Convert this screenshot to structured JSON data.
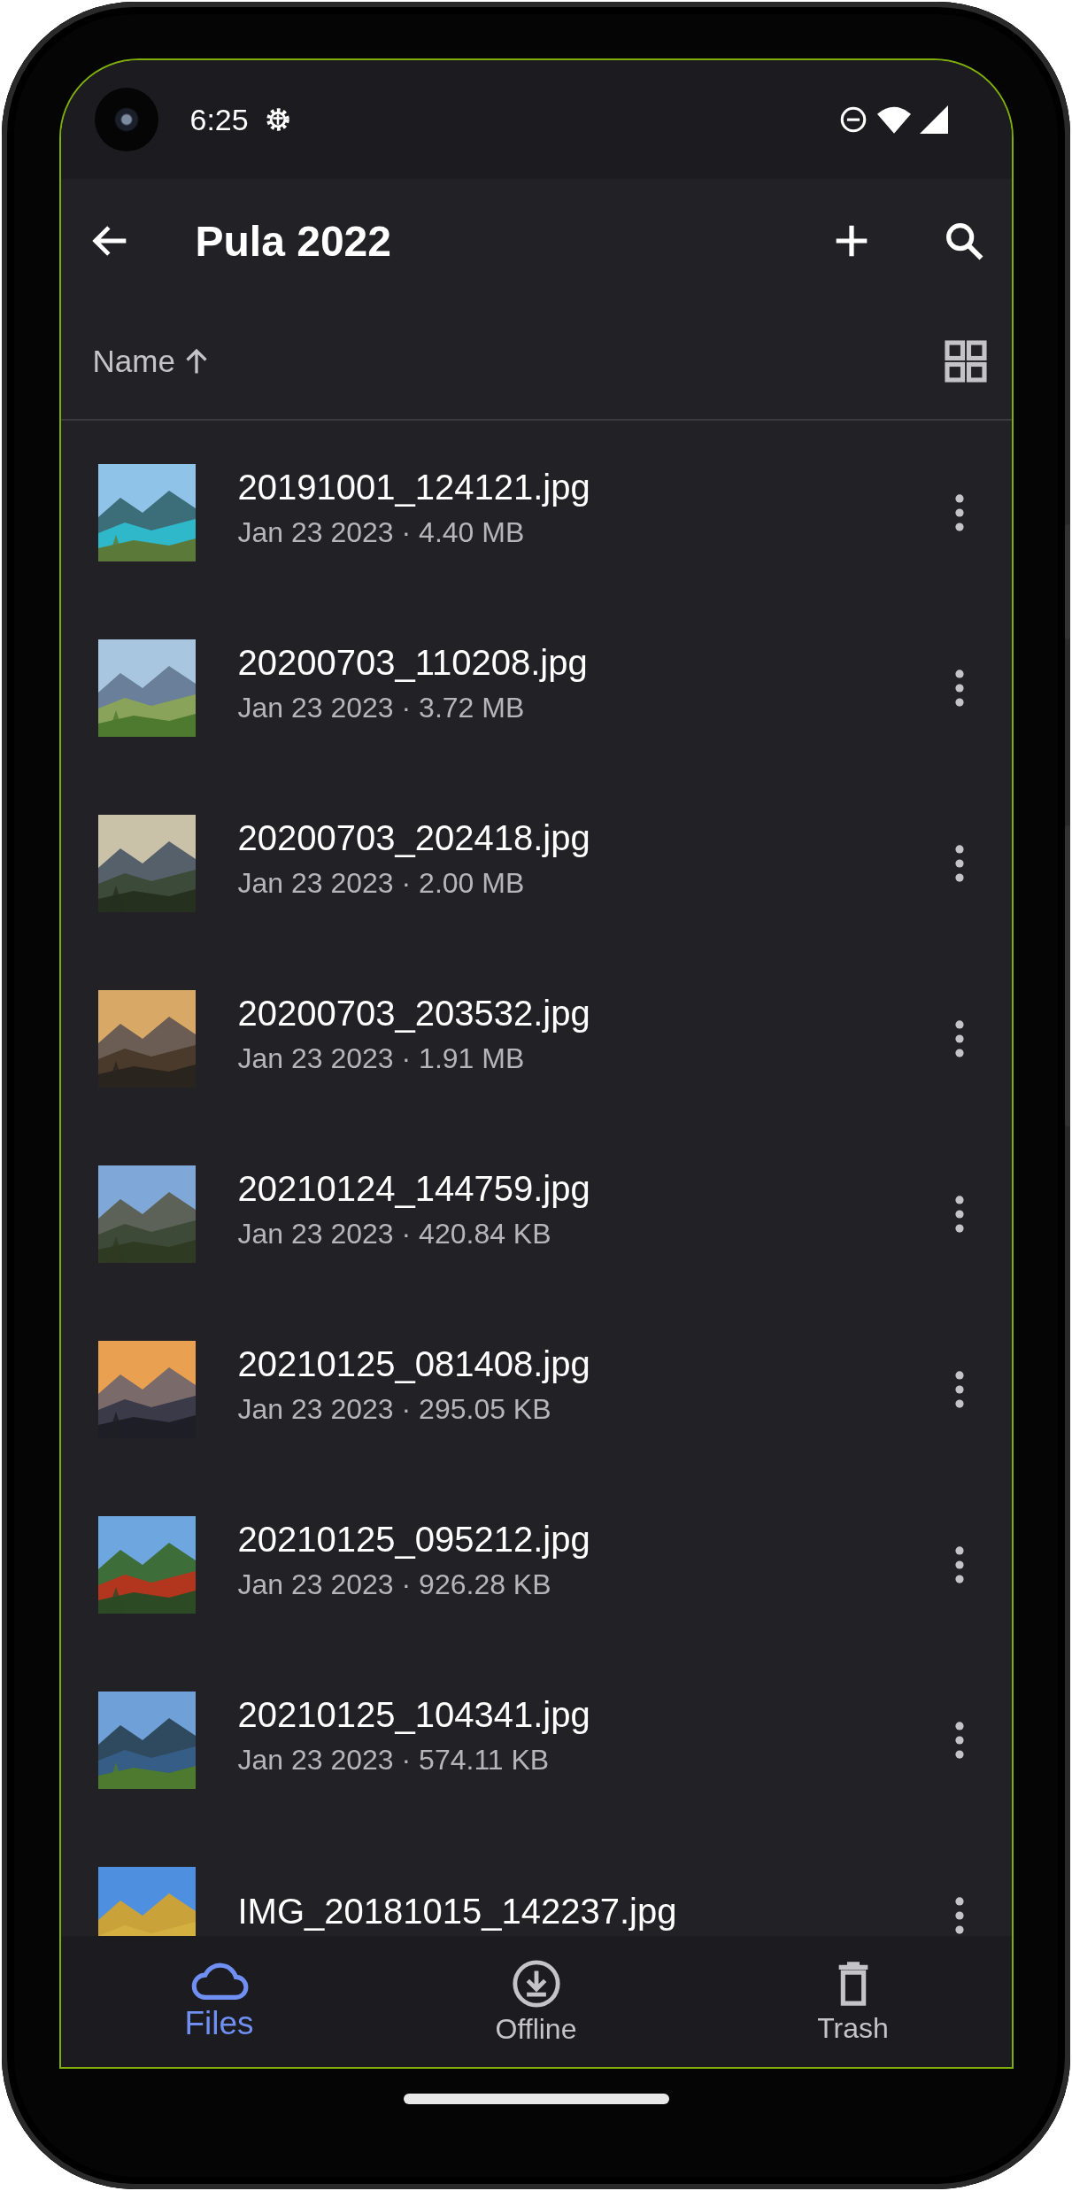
{
  "status_bar": {
    "time": "6:25"
  },
  "app_bar": {
    "title": "Pula 2022"
  },
  "sort": {
    "label": "Name"
  },
  "files": [
    {
      "name": "20191001_124121.jpg",
      "meta": "Jan 23 2023 · 4.40 MB"
    },
    {
      "name": "20200703_110208.jpg",
      "meta": "Jan 23 2023 · 3.72 MB"
    },
    {
      "name": "20200703_202418.jpg",
      "meta": "Jan 23 2023 · 2.00 MB"
    },
    {
      "name": "20200703_203532.jpg",
      "meta": "Jan 23 2023 · 1.91 MB"
    },
    {
      "name": "20210124_144759.jpg",
      "meta": "Jan 23 2023 · 420.84 KB"
    },
    {
      "name": "20210125_081408.jpg",
      "meta": "Jan 23 2023 · 295.05 KB"
    },
    {
      "name": "20210125_095212.jpg",
      "meta": "Jan 23 2023 · 926.28 KB"
    },
    {
      "name": "20210125_104341.jpg",
      "meta": "Jan 23 2023 · 574.11 KB"
    },
    {
      "name": "IMG_20181015_142237.jpg"
    }
  ],
  "bottom_nav": [
    {
      "kind": "cloud",
      "label": "Files",
      "selected": true
    },
    {
      "kind": "download",
      "label": "Offline",
      "selected": false
    },
    {
      "kind": "trash",
      "label": "Trash",
      "selected": false
    }
  ]
}
